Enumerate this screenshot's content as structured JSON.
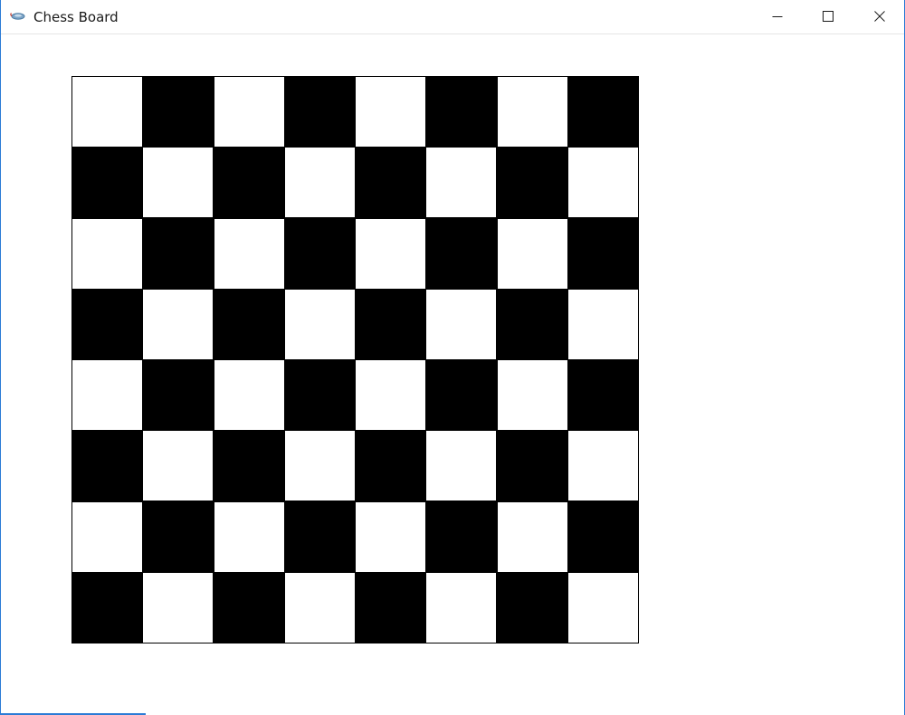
{
  "window": {
    "title": "Chess Board",
    "icon": "java-app-icon",
    "controls": [
      "minimize-icon",
      "maximize-icon",
      "close-icon"
    ]
  },
  "board": {
    "rows": 8,
    "cols": 8,
    "top_left_color": "light",
    "colors": {
      "light": "#ffffff",
      "dark": "#000000"
    }
  },
  "colors": {
    "window_border": "#2b7bd6",
    "titlebar_background": "#ffffff",
    "title_text": "#1a1a1a"
  }
}
